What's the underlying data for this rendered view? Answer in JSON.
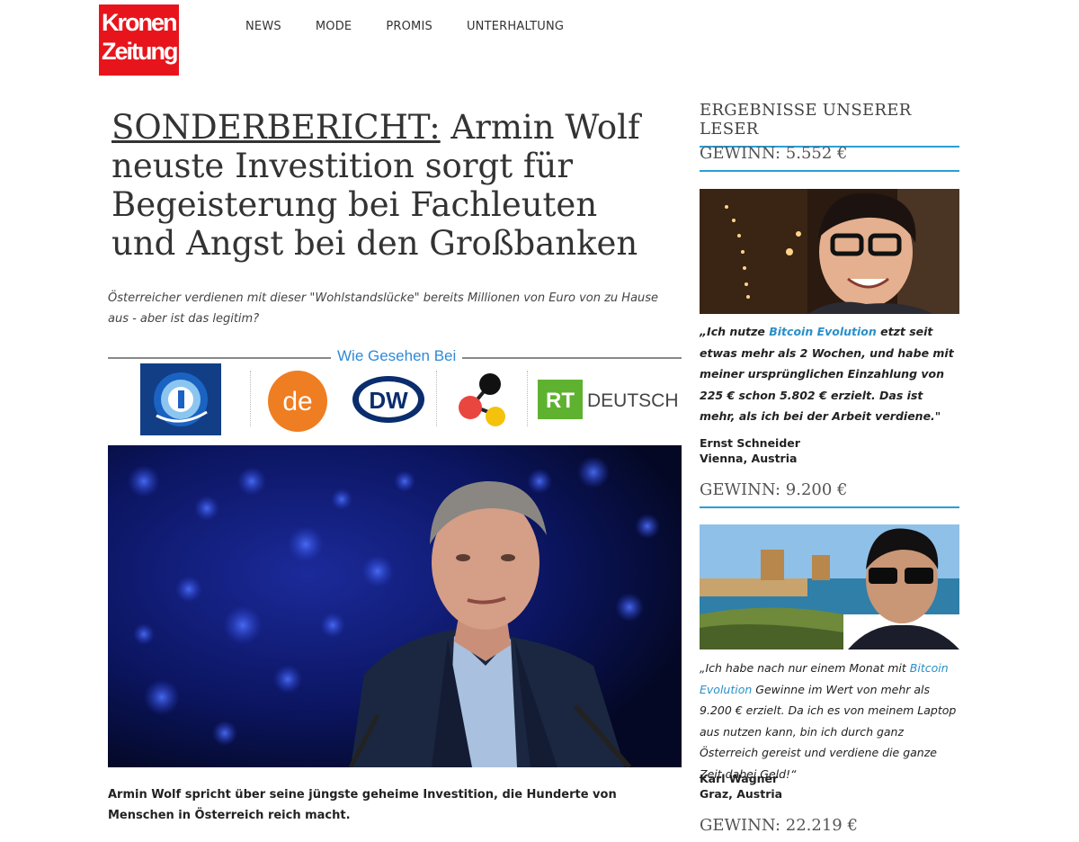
{
  "logo": {
    "line1": "Kronen",
    "line2": "Zeitung"
  },
  "nav": [
    "NEWS",
    "MODE",
    "PROMIS",
    "UNTERHALTUNG"
  ],
  "article": {
    "headline_prefix": "SONDERBERICHT:",
    "headline_rest": " Armin Wolf neuste Investition sorgt für Begeisterung bei Fachleuten und Angst bei den Großbanken",
    "subtitle": "Österreicher verdienen mit dieser \"Wohlstandslücke\" bereits Millionen von Euro von zu Hause aus - aber ist das legitim?",
    "seen_label": "Wie Gesehen Bei",
    "media": {
      "de": "de",
      "dw": "DW",
      "rt": "RT",
      "rt_text": "DEUTSCH"
    },
    "caption": "Armin Wolf spricht über seine jüngste geheime Investition, die Hunderte von Menschen in Österreich reich macht."
  },
  "sidebar": {
    "title": "ERGEBNISSE UNSERER LESER",
    "testimonials": [
      {
        "gain": "GEWINN: 5.552 €",
        "quote_before": "„Ich nutze ",
        "quote_link": "Bitcoin Evolution",
        "quote_after": " etzt seit etwas mehr als 2 Wochen, und habe mit meiner ursprünglichen Einzahlung von 225 € schon 5.802 € erzielt. Das ist mehr, als ich bei der Arbeit verdiene.\"",
        "name": "Ernst Schneider",
        "location": "Vienna, Austria"
      },
      {
        "gain": "GEWINN: 9.200 €",
        "quote_before": "„Ich habe nach nur einem Monat mit ",
        "quote_link": "Bitcoin Evolution",
        "quote_after": " Gewinne im Wert von mehr als 9.200 € erzielt. Da ich es von meinem Laptop aus nutzen kann, bin ich durch ganz Österreich gereist und verdiene die ganze Zeit dabei Geld!“",
        "name": "Karl Wagner",
        "location": "Graz, Austria"
      }
    ],
    "next_gain": "GEWINN: 22.219 €"
  },
  "colors": {
    "brand_red": "#e8141c",
    "accent_blue": "#2a9fd6",
    "link_blue": "#2a8fc9"
  }
}
